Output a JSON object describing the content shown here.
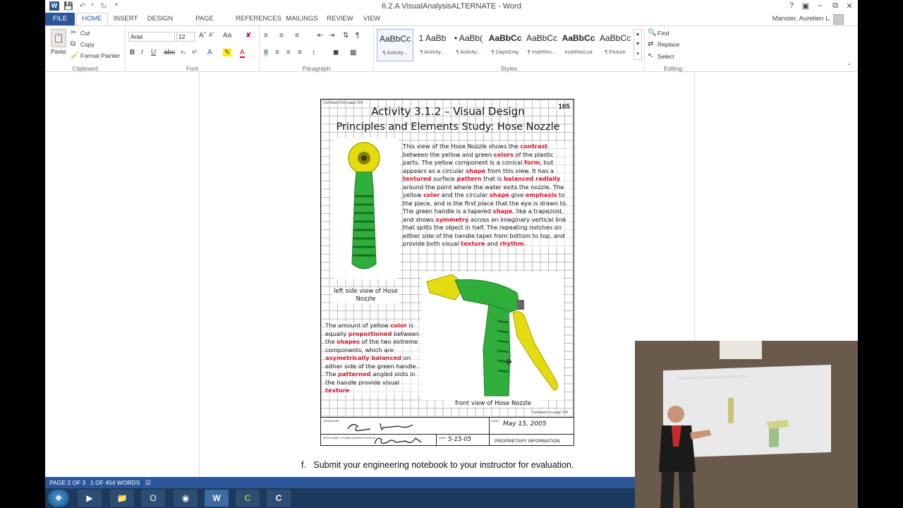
{
  "titlebar": {
    "doc_title": "6.2.A VisualAnalysisALTERNATE - Word",
    "help": "?",
    "minimize": "–",
    "restore": "⧉",
    "close": "✕"
  },
  "tabs": [
    "FILE",
    "HOME",
    "INSERT",
    "DESIGN",
    "PAGE LAYOUT",
    "REFERENCES",
    "MAILINGS",
    "REVIEW",
    "VIEW"
  ],
  "user": "Mansier, Aurelien L.",
  "ribbon": {
    "clipboard": {
      "paste": "Paste",
      "cut": "Cut",
      "copy": "Copy",
      "format_painter": "Format Painter",
      "label": "Clipboard"
    },
    "font": {
      "name": "Arial",
      "size": "12",
      "label": "Font"
    },
    "paragraph": {
      "label": "Paragraph"
    },
    "styles": {
      "label": "Styles",
      "items": [
        {
          "preview": "AaBbCc",
          "name": "¶ Activity..."
        },
        {
          "preview": "1  AaBb",
          "name": "¶ Activity..."
        },
        {
          "preview": "•  AaBb(",
          "name": "¶ Activity..."
        },
        {
          "preview": "AaBbCc",
          "name": "¶ DaytoDay"
        },
        {
          "preview": "AaBbCc",
          "name": "¶ InstrRes..."
        },
        {
          "preview": "AaBbCc",
          "name": "InstrResList"
        },
        {
          "preview": "AaBbCc",
          "name": "¶ Picture"
        }
      ]
    },
    "editing": {
      "find": "Find",
      "replace": "Replace",
      "select": "Select",
      "label": "Editing"
    }
  },
  "notebook": {
    "continued_from": "Continued from page",
    "continued_from_page": "164",
    "page_number": "165",
    "title_line1": "Activity 3.1.2 – Visual Design",
    "title_line2": "Principles and Elements Study: Hose Nozzle",
    "caption_left": "left side view of Hose Nozzle",
    "caption_front": "front view of Hose Nozzle",
    "continued_on": "Continued on page",
    "continued_on_page": "166",
    "signature_label": "SIGNATURE",
    "date_label": "DATE",
    "disclosed_label": "DISCLOSED TO AND UNDERSTOOD BY",
    "date1": "May 15, 2005",
    "date2": "5-15-05",
    "proprietary": "PROPRIETARY INFORMATION"
  },
  "document": {
    "step_letter": "f.",
    "step_text": "Submit your engineering notebook to your instructor for evaluation."
  },
  "status": {
    "page": "PAGE 2 OF 3",
    "words": "1 OF 454 WORDS"
  },
  "taskbar": {
    "items": [
      "start",
      "media",
      "outlook",
      "chrome",
      "word",
      "camtasia",
      "camtasia-recorder"
    ]
  },
  "colors": {
    "accent": "#2b579a",
    "keyword_red": "#d4142a",
    "nozzle_green": "#2fae3b",
    "nozzle_yellow": "#e4dc10"
  }
}
